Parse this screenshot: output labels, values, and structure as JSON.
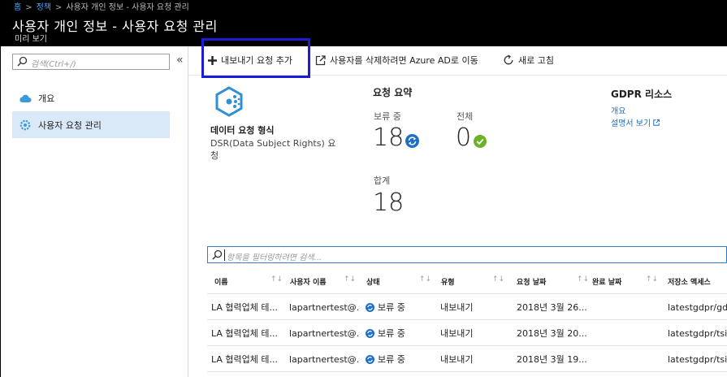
{
  "header": {
    "breadcrumb": [
      "홈",
      "정책",
      "사용자 개인 정보 - 사용자 요청 관리"
    ],
    "title": "사용자 개인 정보 - 사용자 요청 관리",
    "subtitle": "미리 보기"
  },
  "sidebar": {
    "search_placeholder": "검색(Ctrl+/)",
    "collapse_glyph": "«",
    "items": [
      {
        "label": "개요",
        "icon": "cloud-icon"
      },
      {
        "label": "사용자 요청 관리",
        "icon": "gear-icon"
      }
    ]
  },
  "toolbar": {
    "add_export_label": "내보내기 요청 추가",
    "delete_in_ad_label": "사용자를 삭제하려면 Azure AD로 이동",
    "refresh_label": "새로 고침"
  },
  "dsr": {
    "title": "데이터 요청 형식",
    "description": "DSR(Data Subject Rights) 요청"
  },
  "summary": {
    "title": "요청 요약",
    "pending_label": "보류 중",
    "pending_value": "18",
    "total_label": "전체",
    "total_value": "0",
    "sum_label": "합계",
    "sum_value": "18"
  },
  "gdpr": {
    "title": "GDPR 리소스",
    "overview_link": "개요",
    "docs_link": "설명서 보기"
  },
  "filter": {
    "placeholder": "항목을 필터링하려면 검색..."
  },
  "table": {
    "columns": [
      "이름",
      "사용자 이름",
      "상태",
      "유형",
      "요청 날짜",
      "완료 날짜",
      "저장소 액세스"
    ],
    "rows": [
      [
        "LA 협력업체 테...",
        "lapartnertest@...",
        "보류 중",
        "내보내기",
        "2018년 3월 26...",
        "",
        "latestgdpr/gdp"
      ],
      [
        "LA 협력업체 테...",
        "lapartnertest@...",
        "보류 중",
        "내보내기",
        "2018년 3월 20...",
        "",
        "latestgdpr/tsit"
      ],
      [
        "LA 협력업체 테...",
        "lapartnertest@...",
        "보류 중",
        "내보내기",
        "2018년 3월 19...",
        "",
        "latestgdpr/tsie"
      ]
    ]
  },
  "colors": {
    "header_bg": "#000000",
    "accent": "#1a6fc9",
    "selected_nav": "#d9e9f7",
    "success": "#6bb324",
    "highlight_box": "#1c1cd4"
  }
}
